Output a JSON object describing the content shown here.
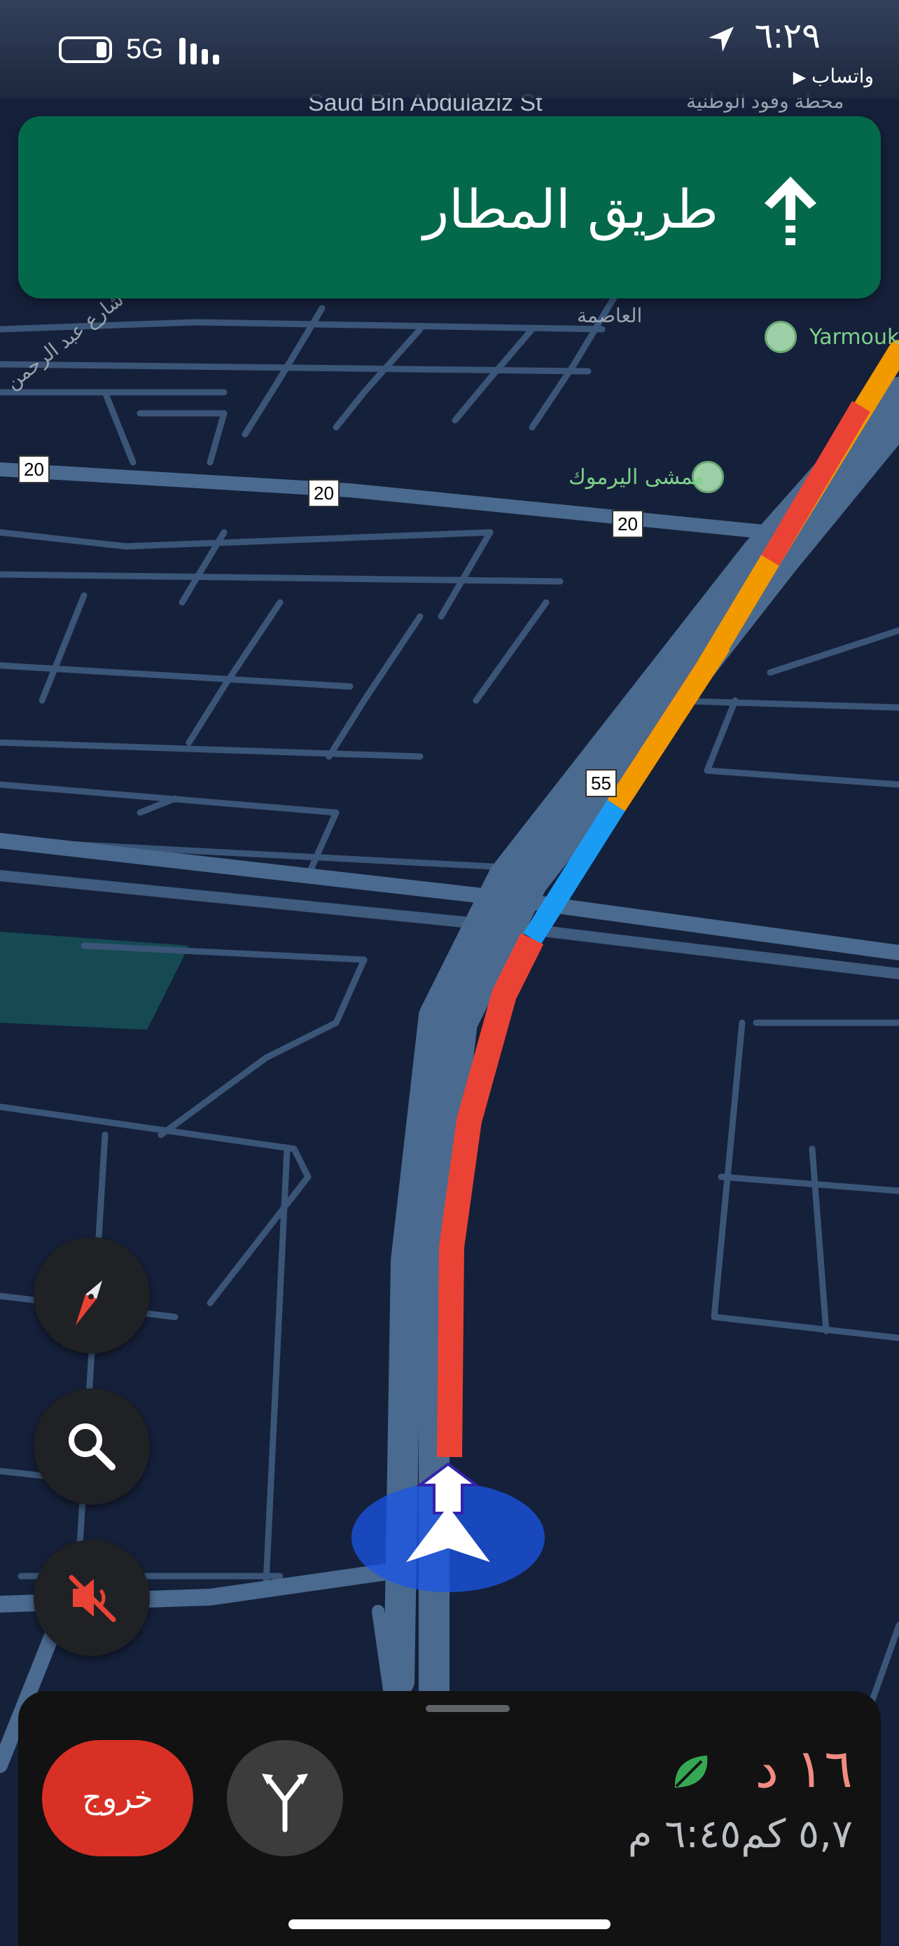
{
  "status_bar": {
    "network": "5G",
    "time": "٦:٢٩",
    "back_app": "واتساب",
    "back_app_glyph": "▶",
    "battery_icon": "battery-icon",
    "signal_icon": "signal-bars-icon",
    "location_icon": "location-arrow-icon"
  },
  "navigation": {
    "next_street": "طريق المطار",
    "maneuver_icon": "straight-arrow-icon",
    "banner_color": "#04694a"
  },
  "map": {
    "street_labels": {
      "top": "Saud Bin Abdulaziz St",
      "top_arabic": "محطة وقود الوطنية",
      "district": "العاصمة",
      "left_street": "شارع عبد الرحمن"
    },
    "pois": [
      {
        "name": "Yarmouk",
        "icon": "park-icon"
      },
      {
        "name": "ممشى اليرموك",
        "icon": "tree-icon"
      }
    ],
    "route_shields": [
      "20",
      "20",
      "20",
      "55"
    ],
    "route_colors": {
      "heavy": "#ea4335",
      "moderate": "#f29900",
      "clear": "#1a9cf5"
    }
  },
  "controls": {
    "compass_icon": "compass-icon",
    "search_icon": "search-icon",
    "mute_icon": "volume-muted-icon"
  },
  "trip": {
    "exit_label": "خروج",
    "alt_routes_icon": "alternate-routes-icon",
    "eta_minutes": "١٦ د",
    "eco_icon": "leaf-icon",
    "details": "٥,٧ كم٦:٤٥ م"
  }
}
